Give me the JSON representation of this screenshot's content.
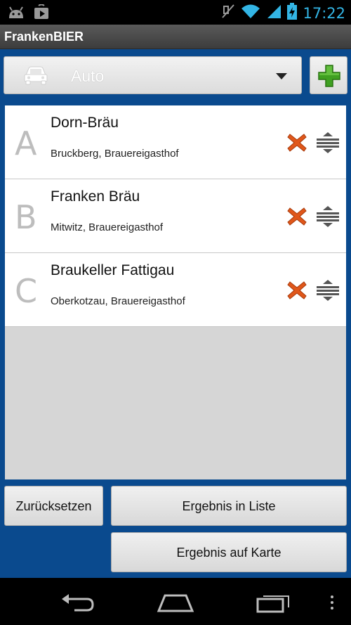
{
  "status_bar": {
    "time": "17:22",
    "icons": [
      "android-icon",
      "play-store-icon",
      "mute-icon",
      "wifi-icon",
      "signal-icon",
      "battery-charging-icon"
    ]
  },
  "app": {
    "title": "FrankenBIER"
  },
  "mode_select": {
    "selected": "Auto",
    "icon": "car-icon"
  },
  "add_button": {
    "icon": "plus-icon",
    "color": "#3a9a1c"
  },
  "destinations": [
    {
      "letter": "A",
      "name": "Dorn-Bräu",
      "subtitle": "Bruckberg, Brauereigasthof"
    },
    {
      "letter": "B",
      "name": "Franken Bräu",
      "subtitle": "Mitwitz, Brauereigasthof"
    },
    {
      "letter": "C",
      "name": "Braukeller Fattigau",
      "subtitle": "Oberkotzau, Brauereigasthof"
    }
  ],
  "buttons": {
    "reset": "Zurücksetzen",
    "result_list": "Ergebnis in Liste",
    "result_map": "Ergebnis auf Karte"
  },
  "nav_bar": {
    "icons": [
      "back-icon",
      "home-icon",
      "recent-apps-icon",
      "menu-icon"
    ]
  },
  "colors": {
    "accent_blue": "#33b5e5",
    "background_blue": "#0a4a8e",
    "delete_orange": "#e0571a"
  }
}
